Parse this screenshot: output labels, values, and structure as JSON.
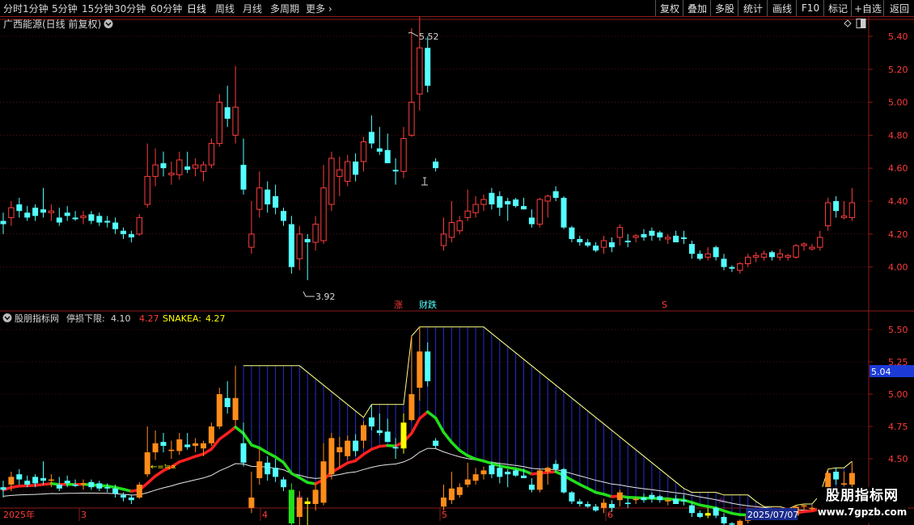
{
  "toolbar": {
    "periods": [
      "分时",
      "1分钟",
      "5分钟",
      "15分钟",
      "30分钟",
      "60分钟",
      "日线",
      "周线",
      "月线",
      "多周期",
      "更多"
    ],
    "active_period": "日线",
    "right_buttons": [
      "复权",
      "叠加",
      "多股",
      "统计",
      "画线",
      "F10",
      "标记",
      "+自选",
      "返回"
    ]
  },
  "stock": {
    "title": "广西能源(日线 前复权)"
  },
  "main_chart": {
    "y_ticks": [
      "5.40",
      "5.20",
      "5.00",
      "4.80",
      "4.60",
      "4.40",
      "4.20",
      "4.00"
    ],
    "high_label": "5.52",
    "low_label": "3.92",
    "markers": {
      "zhang": "涨",
      "caidie": "财跌",
      "s_mark": "S"
    }
  },
  "indicator": {
    "name": "股朋指标网",
    "stop_loss_label": "停损下限:",
    "stop_loss_value": "4.10",
    "value2": "4.27",
    "snakea_label": "SNAKEA:",
    "snakea_value": "4.27",
    "y_ticks": [
      "5.50",
      "5.25",
      "5.00",
      "4.75",
      "4.50",
      "4.25"
    ],
    "current_price": "5.04",
    "annotation": "←=≒∝",
    "star": "☆"
  },
  "time_axis": {
    "labels": [
      "2025年",
      "3",
      "4",
      "5",
      "6"
    ],
    "current_date": "2025/07/07"
  },
  "watermark": {
    "line1": "股朋指标网",
    "line2": "www.7gpzb.com"
  },
  "colors": {
    "up": "#ff3c3c",
    "down": "#54ffff",
    "indicator_up": "#ff8c1a",
    "indicator_yellow": "#ffff00",
    "snake_green": "#22e01a",
    "snake_red": "#ff2020",
    "grid_red": "#8b1a1a"
  },
  "candles": [
    [
      4.28,
      4.33,
      4.2,
      4.26
    ],
    [
      4.3,
      4.4,
      4.25,
      4.36
    ],
    [
      4.38,
      4.42,
      4.3,
      4.34
    ],
    [
      4.33,
      4.37,
      4.28,
      4.3
    ],
    [
      4.36,
      4.38,
      4.28,
      4.31
    ],
    [
      4.35,
      4.48,
      4.3,
      4.33
    ],
    [
      4.33,
      4.38,
      4.28,
      4.34
    ],
    [
      4.3,
      4.36,
      4.25,
      4.27
    ],
    [
      4.33,
      4.37,
      4.28,
      4.31
    ],
    [
      4.3,
      4.34,
      4.28,
      4.29
    ],
    [
      4.3,
      4.34,
      4.26,
      4.31
    ],
    [
      4.32,
      4.34,
      4.26,
      4.28
    ],
    [
      4.31,
      4.33,
      4.25,
      4.27
    ],
    [
      4.28,
      4.31,
      4.24,
      4.27
    ],
    [
      4.27,
      4.3,
      4.2,
      4.23
    ],
    [
      4.22,
      4.24,
      4.17,
      4.2
    ],
    [
      4.2,
      4.22,
      4.15,
      4.18
    ],
    [
      4.2,
      4.32,
      4.19,
      4.3
    ],
    [
      4.38,
      4.75,
      4.36,
      4.55
    ],
    [
      4.55,
      4.72,
      4.49,
      4.62
    ],
    [
      4.63,
      4.7,
      4.55,
      4.6
    ],
    [
      4.56,
      4.64,
      4.5,
      4.57
    ],
    [
      4.56,
      4.7,
      4.53,
      4.65
    ],
    [
      4.61,
      4.7,
      4.57,
      4.59
    ],
    [
      4.6,
      4.66,
      4.55,
      4.62
    ],
    [
      4.58,
      4.64,
      4.52,
      4.62
    ],
    [
      4.62,
      4.78,
      4.6,
      4.75
    ],
    [
      4.75,
      5.05,
      4.73,
      5.0
    ],
    [
      4.97,
      5.1,
      4.85,
      4.9
    ],
    [
      4.8,
      5.22,
      4.75,
      4.97
    ],
    [
      4.62,
      4.78,
      4.44,
      4.47
    ],
    [
      4.12,
      4.4,
      4.08,
      4.2
    ],
    [
      4.35,
      4.58,
      4.3,
      4.48
    ],
    [
      4.47,
      4.52,
      4.33,
      4.38
    ],
    [
      4.43,
      4.5,
      4.32,
      4.36
    ],
    [
      4.34,
      4.36,
      4.25,
      4.28
    ],
    [
      4.26,
      4.31,
      3.96,
      4.0
    ],
    [
      4.05,
      4.25,
      3.98,
      4.2
    ],
    [
      4.17,
      4.2,
      3.92,
      4.15
    ],
    [
      4.15,
      4.31,
      4.1,
      4.26
    ],
    [
      4.16,
      4.62,
      4.14,
      4.48
    ],
    [
      4.38,
      4.7,
      4.34,
      4.66
    ],
    [
      4.55,
      4.67,
      4.43,
      4.59
    ],
    [
      4.52,
      4.68,
      4.49,
      4.64
    ],
    [
      4.64,
      4.69,
      4.52,
      4.56
    ],
    [
      4.64,
      4.79,
      4.58,
      4.76
    ],
    [
      4.82,
      4.92,
      4.72,
      4.75
    ],
    [
      4.72,
      4.85,
      4.68,
      4.7
    ],
    [
      4.71,
      4.81,
      4.63,
      4.63
    ],
    [
      4.59,
      4.66,
      4.5,
      4.58
    ],
    [
      4.58,
      4.85,
      4.54,
      4.78
    ],
    [
      4.8,
      5.45,
      4.79,
      5.0
    ],
    [
      5.05,
      5.52,
      4.95,
      5.33
    ],
    [
      5.33,
      5.4,
      5.06,
      5.1
    ],
    [
      4.64,
      4.66,
      4.58,
      4.6
    ],
    [
      4.13,
      4.3,
      4.1,
      4.2
    ],
    [
      4.18,
      4.4,
      4.15,
      4.27
    ],
    [
      4.22,
      4.31,
      4.2,
      4.28
    ],
    [
      4.3,
      4.47,
      4.28,
      4.34
    ],
    [
      4.33,
      4.43,
      4.3,
      4.38
    ],
    [
      4.38,
      4.44,
      4.34,
      4.41
    ],
    [
      4.45,
      4.48,
      4.35,
      4.38
    ],
    [
      4.43,
      4.46,
      4.31,
      4.36
    ],
    [
      4.4,
      4.42,
      4.28,
      4.38
    ],
    [
      4.41,
      4.42,
      4.36,
      4.37
    ],
    [
      4.37,
      4.42,
      4.35,
      4.35
    ],
    [
      4.3,
      4.35,
      4.24,
      4.26
    ],
    [
      4.26,
      4.42,
      4.24,
      4.41
    ],
    [
      4.4,
      4.44,
      4.3,
      4.43
    ],
    [
      4.46,
      4.49,
      4.4,
      4.42
    ],
    [
      4.42,
      4.43,
      4.23,
      4.24
    ],
    [
      4.24,
      4.25,
      4.15,
      4.17
    ],
    [
      4.17,
      4.19,
      4.13,
      4.15
    ],
    [
      4.15,
      4.17,
      4.12,
      4.13
    ],
    [
      4.13,
      4.15,
      4.09,
      4.1
    ],
    [
      4.12,
      4.19,
      4.08,
      4.16
    ],
    [
      4.15,
      4.18,
      4.09,
      4.12
    ],
    [
      4.18,
      4.26,
      4.13,
      4.24
    ],
    [
      4.16,
      4.2,
      4.12,
      4.15
    ],
    [
      4.18,
      4.2,
      4.15,
      4.19
    ],
    [
      4.2,
      4.23,
      4.16,
      4.18
    ],
    [
      4.22,
      4.24,
      4.16,
      4.19
    ],
    [
      4.21,
      4.22,
      4.16,
      4.18
    ],
    [
      4.17,
      4.2,
      4.14,
      4.18
    ],
    [
      4.19,
      4.22,
      4.15,
      4.15
    ],
    [
      4.18,
      4.22,
      4.14,
      4.17
    ],
    [
      4.14,
      4.16,
      4.05,
      4.08
    ],
    [
      4.08,
      4.1,
      4.04,
      4.05
    ],
    [
      4.06,
      4.12,
      4.04,
      4.08
    ],
    [
      4.12,
      4.13,
      4.04,
      4.06
    ],
    [
      4.05,
      4.08,
      3.98,
      4.0
    ],
    [
      4.0,
      4.01,
      3.97,
      3.99
    ],
    [
      3.98,
      4.03,
      3.96,
      4.02
    ],
    [
      4.02,
      4.08,
      4.0,
      4.06
    ],
    [
      4.06,
      4.09,
      4.03,
      4.07
    ],
    [
      4.06,
      4.1,
      4.04,
      4.08
    ],
    [
      4.09,
      4.1,
      4.04,
      4.06
    ],
    [
      4.06,
      4.11,
      4.04,
      4.08
    ],
    [
      4.06,
      4.08,
      4.04,
      4.07
    ],
    [
      4.06,
      4.14,
      4.05,
      4.13
    ],
    [
      4.13,
      4.15,
      4.1,
      4.14
    ],
    [
      4.11,
      4.14,
      4.1,
      4.12
    ],
    [
      4.12,
      4.22,
      4.1,
      4.18
    ],
    [
      4.25,
      4.42,
      4.22,
      4.39
    ],
    [
      4.4,
      4.43,
      4.3,
      4.34
    ],
    [
      4.3,
      4.4,
      4.29,
      4.31
    ],
    [
      4.3,
      4.48,
      4.28,
      4.39
    ]
  ]
}
